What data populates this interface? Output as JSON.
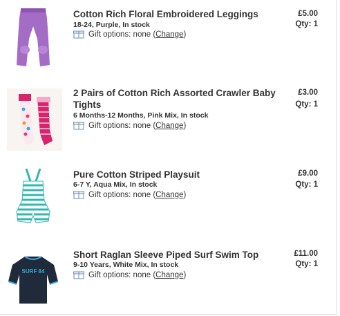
{
  "items": [
    {
      "title": "Cotton Rich Floral Embroidered Leggings",
      "meta": "18-24, Purple, In stock",
      "gift_label": "Gift options: none (",
      "change": "Change",
      "gift_close": ")",
      "price": "£5.00",
      "qty": "Qty: 1",
      "image_icon": "purple-leggings"
    },
    {
      "title": "2 Pairs of Cotton Rich Assorted Crawler Baby Tights",
      "meta": "6 Months-12 Months, Pink Mix, In stock",
      "gift_label": "Gift options: none (",
      "change": "Change",
      "gift_close": ")",
      "price": "£3.00",
      "qty": "Qty: 1",
      "image_icon": "baby-tights"
    },
    {
      "title": "Pure Cotton Striped Playsuit",
      "meta": "6-7 Y, Aqua Mix, In stock",
      "gift_label": "Gift options: none (",
      "change": "Change",
      "gift_close": ")",
      "price": "£9.00",
      "qty": "Qty: 1",
      "image_icon": "striped-playsuit"
    },
    {
      "title": "Short Raglan Sleeve Piped Surf Swim Top",
      "meta": "9-10 Years, White Mix, In stock",
      "gift_label": "Gift options: none (",
      "change": "Change",
      "gift_close": ")",
      "price": "£11.00",
      "qty": "Qty: 1",
      "image_icon": "surf-swim-top",
      "shirt_print": "SURF 84"
    }
  ],
  "colors": {
    "text": "#333333",
    "border": "#d9d9d9",
    "leggings": "#a46cc4",
    "tights_pink": "#d8246c",
    "playsuit_aqua": "#2fb8b0",
    "swim_top": "#1f2a3a"
  }
}
